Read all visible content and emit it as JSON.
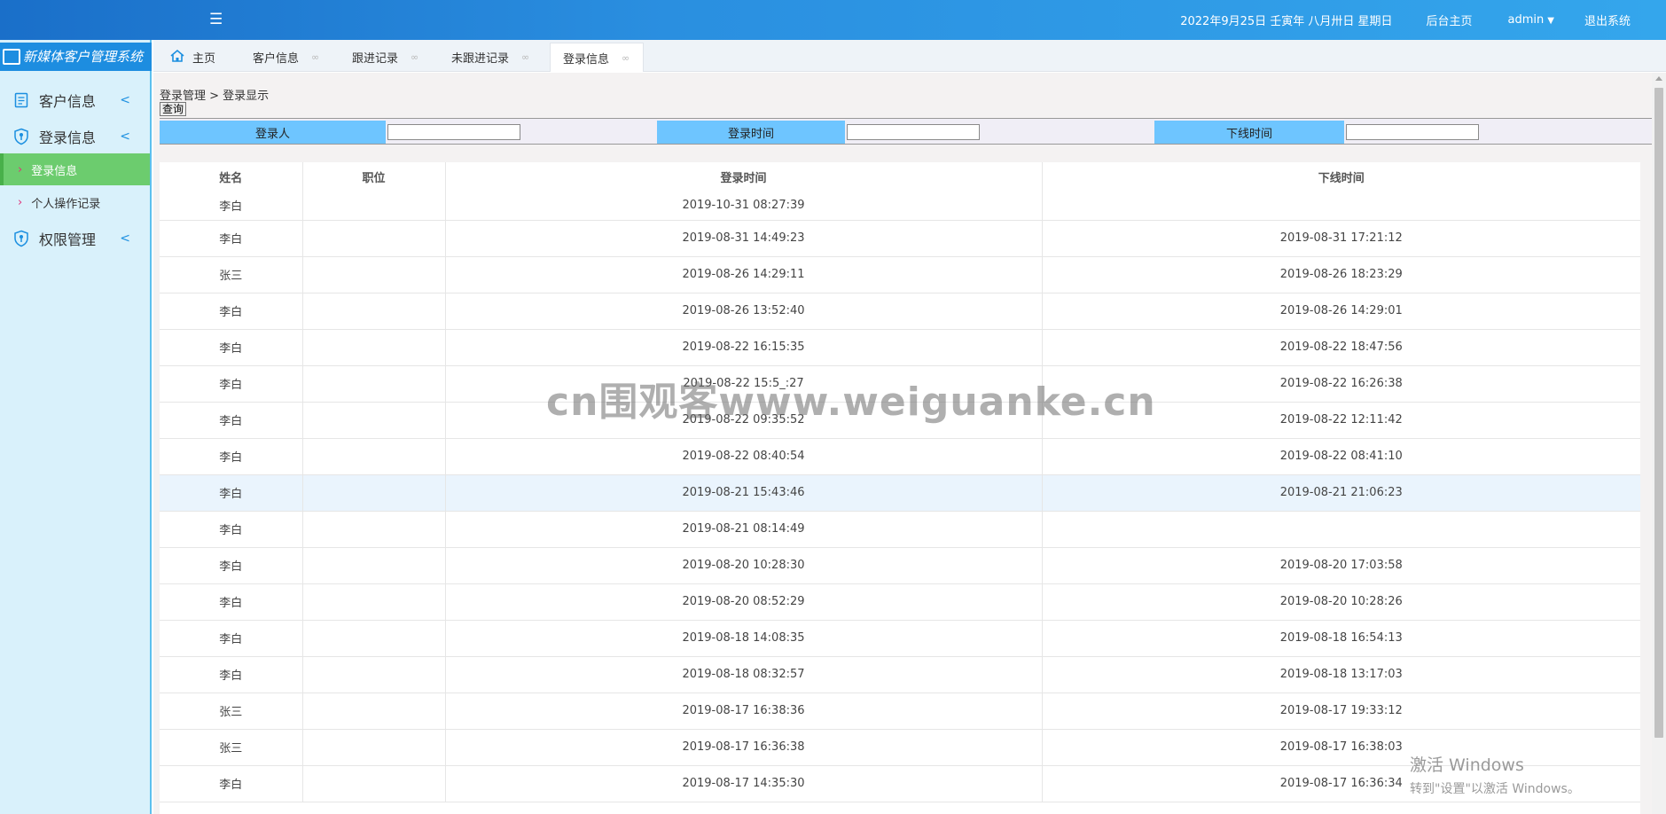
{
  "topbar": {
    "menu_toggle_icon": "menu-fold-icon",
    "date": "2022年9月25日 壬寅年 八月卅日 星期日",
    "home_link": "后台主页",
    "user": "admin",
    "user_caret": "▼",
    "logout": "退出系统"
  },
  "sidebar": {
    "logo": "新媒体客户管理系统",
    "items": [
      {
        "label": "客户信息",
        "icon": "document-icon",
        "chevron": "<"
      },
      {
        "label": "登录信息",
        "icon": "shield-icon",
        "chevron": "<"
      },
      {
        "label": "权限管理",
        "icon": "shield-icon",
        "chevron": "<"
      }
    ],
    "sub_items": [
      {
        "label": "登录信息",
        "arrow": "›",
        "active": true
      },
      {
        "label": "个人操作记录",
        "arrow": "›",
        "active": false
      }
    ]
  },
  "tabs": [
    {
      "label": "主页",
      "icon": "home-icon"
    },
    {
      "label": "客户信息",
      "close": "∞"
    },
    {
      "label": "跟进记录",
      "close": "∞"
    },
    {
      "label": "未跟进记录",
      "close": "∞"
    },
    {
      "label": "登录信息",
      "close": "∞",
      "active": true
    }
  ],
  "breadcrumb": "登录管理 > 登录显示",
  "query_button": "查询",
  "filter": {
    "login_user_label": "登录人",
    "login_time_label": "登录时间",
    "logout_time_label": "下线时间",
    "login_user_value": "",
    "login_time_value": "",
    "logout_time_value": ""
  },
  "table": {
    "columns": [
      "姓名",
      "职位",
      "登录时间",
      "下线时间"
    ],
    "rows": [
      [
        "李白",
        "",
        "2019-10-31 08:27:39",
        ""
      ],
      [
        "李白",
        "",
        "2019-08-31 14:49:23",
        "2019-08-31 17:21:12"
      ],
      [
        "张三",
        "",
        "2019-08-26 14:29:11",
        "2019-08-26 18:23:29"
      ],
      [
        "李白",
        "",
        "2019-08-26 13:52:40",
        "2019-08-26 14:29:01"
      ],
      [
        "李白",
        "",
        "2019-08-22 16:15:35",
        "2019-08-22 18:47:56"
      ],
      [
        "李白",
        "",
        "2019-08-22 15:5_:27",
        "2019-08-22 16:26:38"
      ],
      [
        "李白",
        "",
        "2019-08-22 09:35:52",
        "2019-08-22 12:11:42"
      ],
      [
        "李白",
        "",
        "2019-08-22 08:40:54",
        "2019-08-22 08:41:10"
      ],
      [
        "李白",
        "",
        "2019-08-21 15:43:46",
        "2019-08-21 21:06:23"
      ],
      [
        "李白",
        "",
        "2019-08-21 08:14:49",
        ""
      ],
      [
        "李白",
        "",
        "2019-08-20 10:28:30",
        "2019-08-20 17:03:58"
      ],
      [
        "李白",
        "",
        "2019-08-20 08:52:29",
        "2019-08-20 10:28:26"
      ],
      [
        "李白",
        "",
        "2019-08-18 14:08:35",
        "2019-08-18 16:54:13"
      ],
      [
        "李白",
        "",
        "2019-08-18 08:32:57",
        "2019-08-18 13:17:03"
      ],
      [
        "张三",
        "",
        "2019-08-17 16:38:36",
        "2019-08-17 19:33:12"
      ],
      [
        "张三",
        "",
        "2019-08-17 16:36:38",
        "2019-08-17 16:38:03"
      ],
      [
        "李白",
        "",
        "2019-08-17 14:35:30",
        "2019-08-17 16:36:34"
      ]
    ],
    "highlight_row": 8
  },
  "watermark": "cn围观客www.weiguanke.cn",
  "activation": {
    "title": "激活 Windows",
    "subtitle": "转到\"设置\"以激活 Windows。"
  }
}
